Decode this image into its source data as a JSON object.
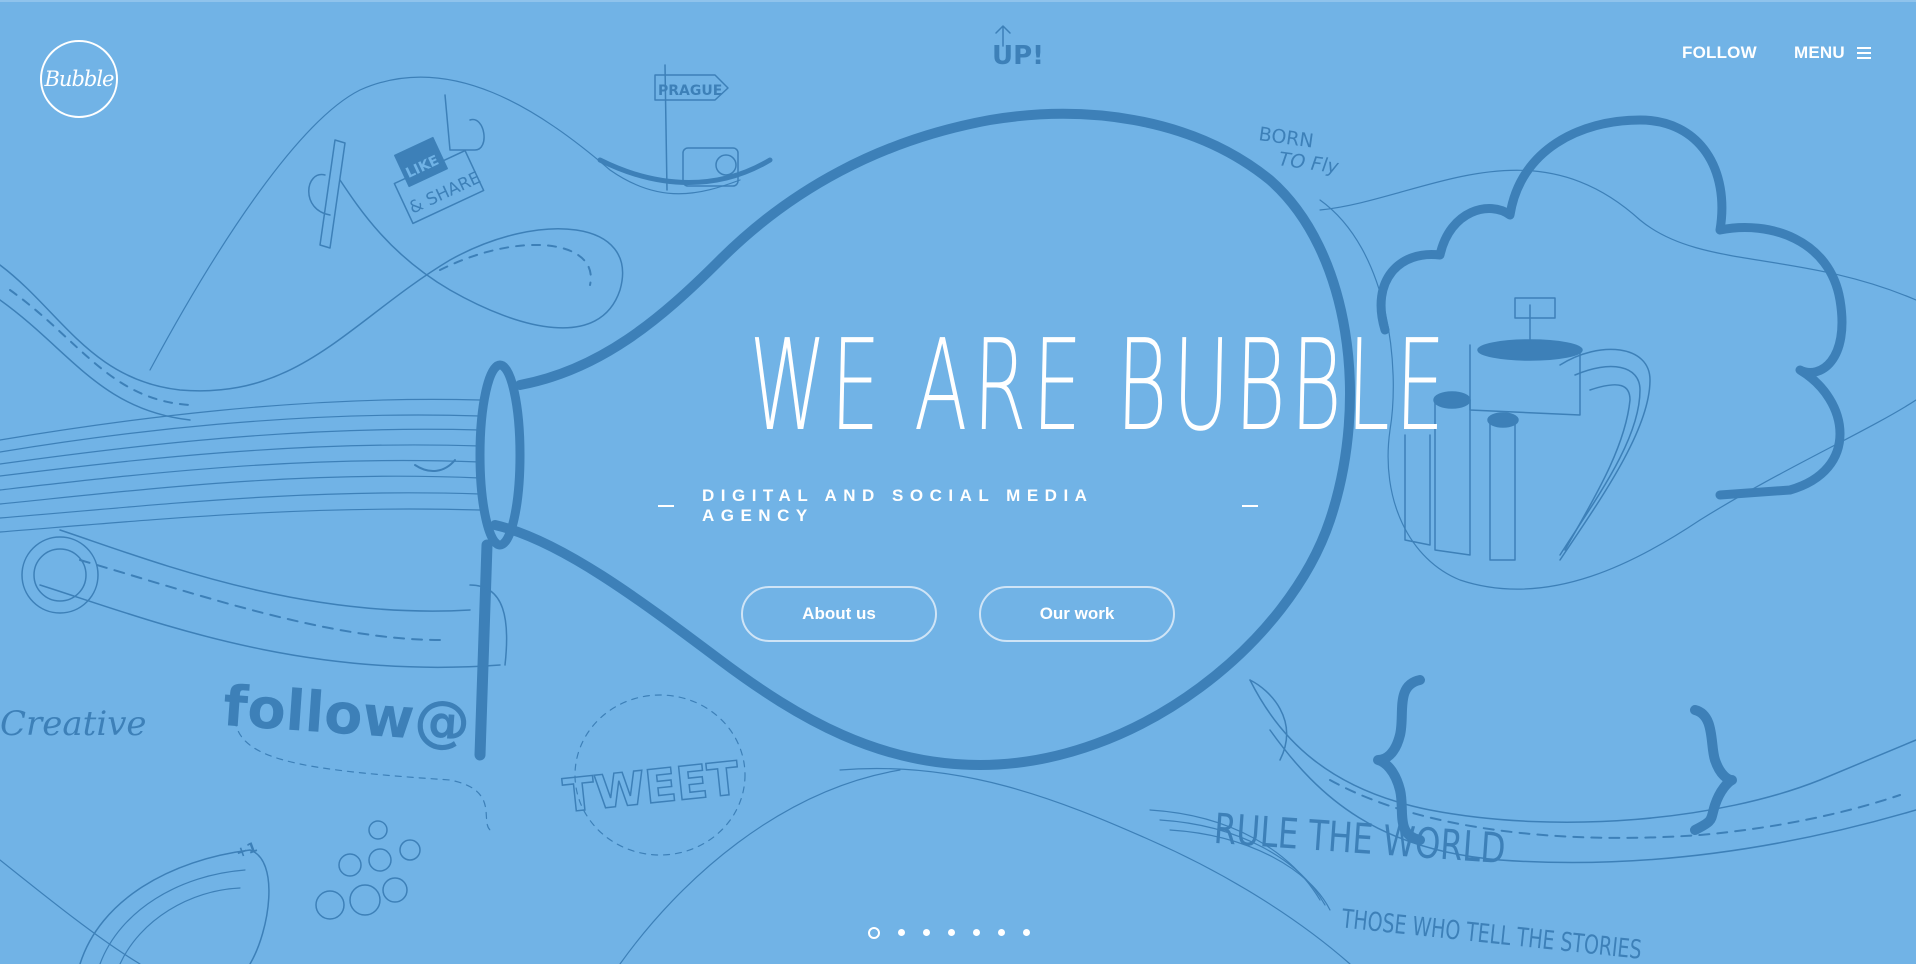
{
  "header": {
    "logo_text": "Bubble",
    "follow_label": "FOLLOW",
    "menu_label": "MENU"
  },
  "hero": {
    "title": "WE ARE BUBBLE",
    "tagline": "DIGITAL AND SOCIAL MEDIA AGENCY",
    "buttons": {
      "about": "About us",
      "work": "Our work"
    }
  },
  "illustration": {
    "up_text": "UP!",
    "prague_sign": "PRAGUE",
    "born_to_fly": [
      "BORN",
      "TO Fly"
    ],
    "like_text": "LIKE",
    "share_text": "& SHARE",
    "follow_text": "follow@",
    "creative_text": "Creative",
    "tweet_text": "TWEET",
    "plus_one_text": "+1",
    "quote_line1": "THOSE WHO TELL THE STORIES",
    "quote_line2": "RULE THE WORLD"
  },
  "pagination": {
    "count": 7,
    "active_index": 0
  },
  "colors": {
    "background": "#71b3e6",
    "line": "#3d80b8",
    "text": "#ffffff"
  }
}
